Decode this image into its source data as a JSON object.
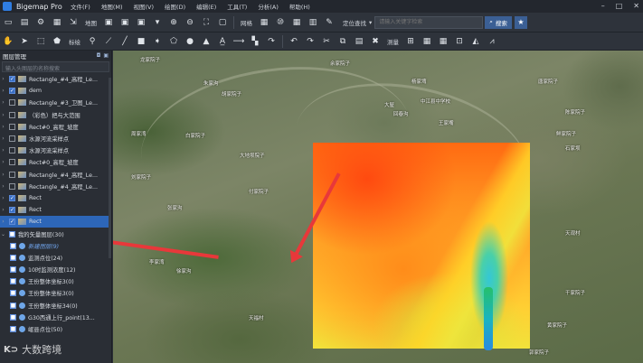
{
  "app": {
    "title": "Bigemap Pro"
  },
  "menu": [
    "文件(F)",
    "地图(M)",
    "视图(V)",
    "绘图(D)",
    "编辑(E)",
    "工具(T)",
    "分析(A)",
    "帮助(H)"
  ],
  "toolbar1": {
    "map_label": "地图",
    "grid_label": "网格",
    "search_mode": "定位查找",
    "search_placeholder": "请输入关键字检索",
    "search_button": "搜索"
  },
  "toolbar2": {
    "annotate_label": "标绘",
    "measure_label": "测量"
  },
  "panel": {
    "title": "图层管理",
    "filter_placeholder": "输入头图层的名称搜索",
    "layers": [
      {
        "label": "Rectangle_#4_高程_Le...",
        "checked": true,
        "kind": "raster"
      },
      {
        "label": "dem",
        "checked": true,
        "kind": "raster"
      },
      {
        "label": "Rectangle_#3_卫图_Le...",
        "checked": false,
        "kind": "raster"
      },
      {
        "label": "（彩色）把与大范围",
        "checked": false,
        "kind": "raster"
      },
      {
        "label": "Rect#0_高程_坡度",
        "checked": false,
        "kind": "raster"
      },
      {
        "label": "水源河流采样点",
        "checked": false,
        "kind": "raster"
      },
      {
        "label": "水源河流采样点",
        "checked": false,
        "kind": "raster"
      },
      {
        "label": "Rect#0_高程_坡度",
        "checked": false,
        "kind": "raster"
      },
      {
        "label": "Rectangle_#4_高程_Le...",
        "checked": false,
        "kind": "raster"
      },
      {
        "label": "Rectangle_#4_高程_Le...",
        "checked": false,
        "kind": "raster"
      },
      {
        "label": "Rect",
        "checked": true,
        "kind": "raster"
      },
      {
        "label": "Rect",
        "checked": true,
        "kind": "raster"
      },
      {
        "label": "Rect",
        "checked": true,
        "kind": "raster",
        "selected": true
      }
    ],
    "vector_group": {
      "label": "我的矢量图层(30)"
    },
    "vector_layers": [
      {
        "label": "新建图层(9)",
        "style": "blue"
      },
      {
        "label": "监测点位(24)",
        "style": "normal"
      },
      {
        "label": "10时监测浓度(12)",
        "style": "normal"
      },
      {
        "label": "王份整体坐标3(0)",
        "style": "normal"
      },
      {
        "label": "王份整体坐标3(0)",
        "style": "normal"
      },
      {
        "label": "王份整体坐标34(0)",
        "style": "normal"
      },
      {
        "label": "G30西通上行_point(13...",
        "style": "normal"
      },
      {
        "label": "岷县点位(50)",
        "style": "normal"
      }
    ]
  },
  "map": {
    "places": [
      {
        "name": "龙家院子"
      },
      {
        "name": "朱家沟"
      },
      {
        "name": "余家院子"
      },
      {
        "name": "周家湾"
      },
      {
        "name": "大地坝院子"
      },
      {
        "name": "回春沟"
      },
      {
        "name": "胡家院子"
      },
      {
        "name": "杨家塆"
      },
      {
        "name": "白家院子"
      },
      {
        "name": "付家院子"
      },
      {
        "name": "刘家院子"
      },
      {
        "name": "张家沟"
      },
      {
        "name": "李家湾"
      },
      {
        "name": "中江县中学校"
      },
      {
        "name": "大屋"
      },
      {
        "name": "王家嘴"
      },
      {
        "name": "陈家院子"
      },
      {
        "name": "唐家院子"
      },
      {
        "name": "鲜家院子"
      },
      {
        "name": "石家坝"
      },
      {
        "name": "天福村"
      },
      {
        "name": "天观村"
      },
      {
        "name": "黄家院子"
      },
      {
        "name": "干家院子"
      },
      {
        "name": "郭家院子"
      },
      {
        "name": "徐家沟"
      }
    ]
  },
  "watermark": {
    "logo": "K⊃",
    "text": "大数跨境"
  },
  "colors": {
    "selection": "#2d66b8",
    "arrow": "#e8383a",
    "accent": "#3b5f94"
  }
}
